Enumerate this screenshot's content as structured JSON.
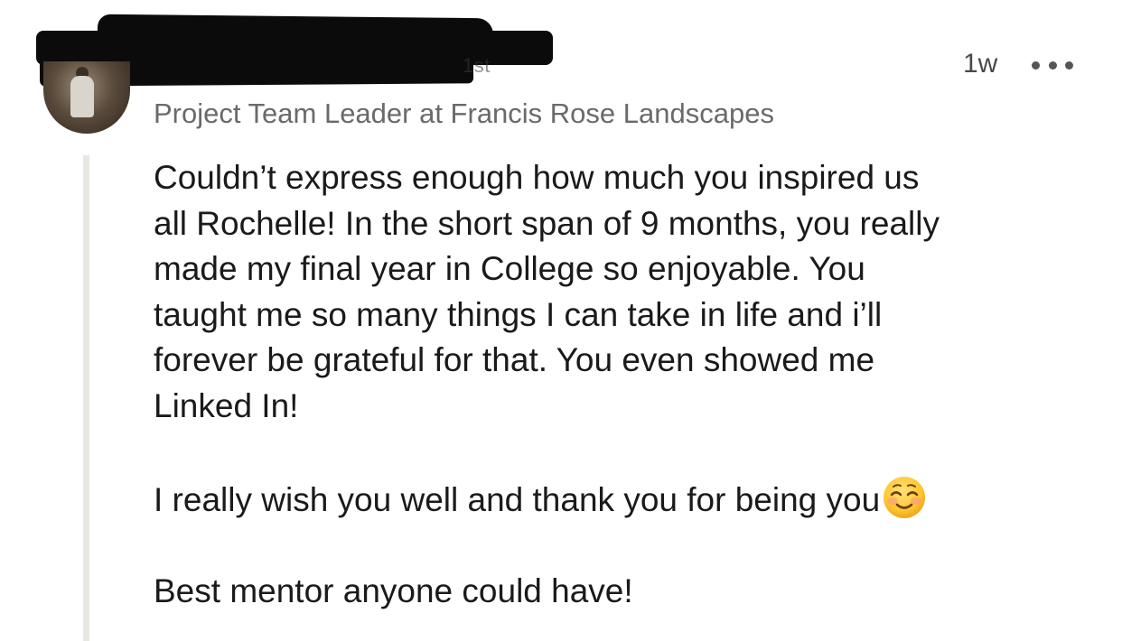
{
  "author": {
    "connection_degree": "1st",
    "headline": "Project Team Leader at Francis Rose Landscapes"
  },
  "post_meta": {
    "timestamp": "1w",
    "more_icon": "more-horizontal-icon"
  },
  "comment": {
    "lines": [
      "Couldn’t express enough how much you inspired us",
      "all Rochelle! In the short span of 9 months, you really",
      "made my final year in College so enjoyable. You",
      "taught me so many things I can take in life and i’ll",
      "forever be grateful for that. You even showed me",
      "Linked In!"
    ],
    "line_wish": "I really wish you well and thank you for being you",
    "emoji": "smiling-face-emoji",
    "line_final": "Best mentor anyone could have!"
  },
  "colors": {
    "text_primary": "#1a1a1a",
    "text_secondary": "#6a6a6a",
    "thread_line": "#e8e6e1",
    "redaction": "#0b0b0b"
  }
}
